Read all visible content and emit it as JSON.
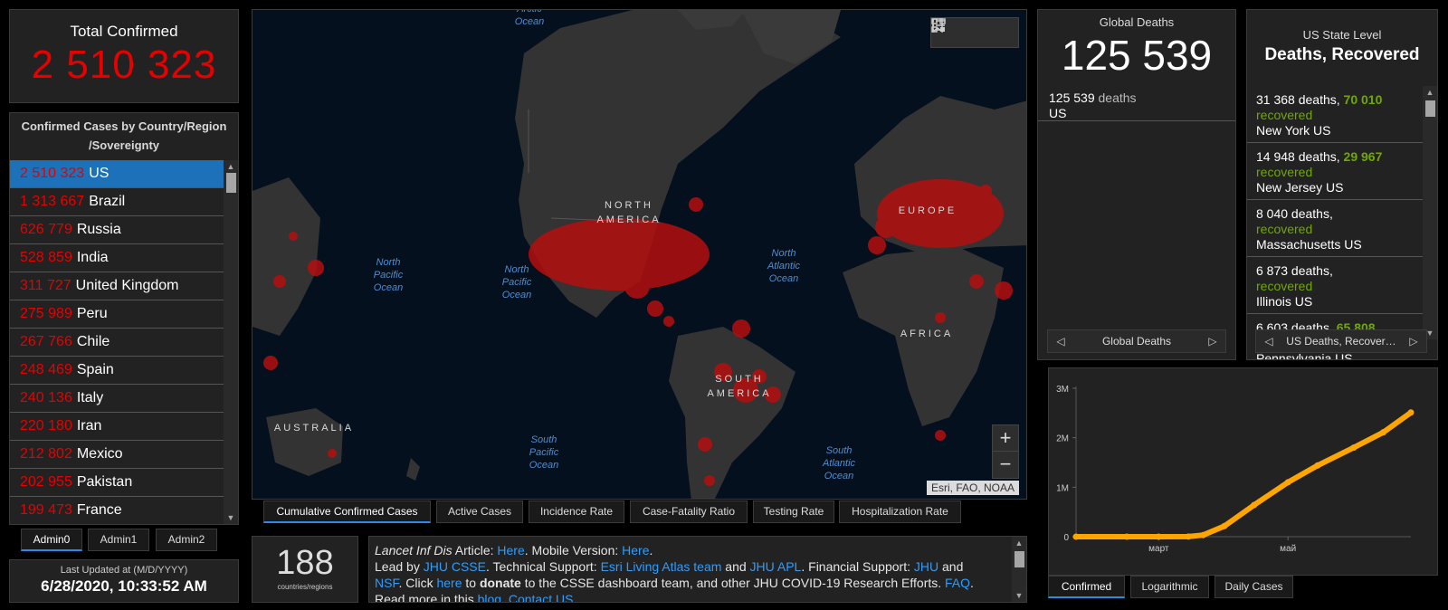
{
  "total": {
    "title": "Total Confirmed",
    "value": "2 510 323"
  },
  "countries": {
    "header_line1": "Confirmed Cases by Country/Region",
    "header_line2": "/Sovereignty",
    "items": [
      {
        "count": "2 510 323",
        "name": "US"
      },
      {
        "count": "1 313 667",
        "name": "Brazil"
      },
      {
        "count": "626 779",
        "name": "Russia"
      },
      {
        "count": "528 859",
        "name": "India"
      },
      {
        "count": "311 727",
        "name": "United Kingdom"
      },
      {
        "count": "275 989",
        "name": "Peru"
      },
      {
        "count": "267 766",
        "name": "Chile"
      },
      {
        "count": "248 469",
        "name": "Spain"
      },
      {
        "count": "240 136",
        "name": "Italy"
      },
      {
        "count": "220 180",
        "name": "Iran"
      },
      {
        "count": "212 802",
        "name": "Mexico"
      },
      {
        "count": "202 955",
        "name": "Pakistan"
      },
      {
        "count": "199 473",
        "name": "France"
      }
    ]
  },
  "admin_tabs": [
    "Admin0",
    "Admin1",
    "Admin2"
  ],
  "last_updated": {
    "title": "Last Updated at (M/D/YYYY)",
    "value": "6/28/2020, 10:33:52 AM"
  },
  "map": {
    "labels": {
      "arctic": "Arctic\nOcean",
      "north_pacific_w": "North\nPacific\nOcean",
      "north_pacific_e": "North\nPacific\nOcean",
      "north_atlantic": "North\nAtlantic\nOcean",
      "south_pacific": "South\nPacific\nOcean",
      "south_atlantic": "South\nAtlantic\nOcean",
      "north_america": "NORTH\nAMERICA",
      "south_america": "SOUTH\nAMERICA",
      "europe": "EUROPE",
      "africa": "AFRICA",
      "australia": "AUSTRALIA"
    },
    "attribution": "Esri, FAO, NOAA",
    "zoom_in": "+",
    "zoom_out": "−",
    "tabs": [
      "Cumulative Confirmed Cases",
      "Active Cases",
      "Incidence Rate",
      "Case-Fatality Ratio",
      "Testing Rate",
      "Hospitalization Rate"
    ]
  },
  "countries_count": {
    "value": "188",
    "label": "countries/regions"
  },
  "info": {
    "lancet": "Lancet Inf Dis",
    "article": " Article: ",
    "here1": "Here",
    "mobile": ". Mobile Version: ",
    "here2": "Here",
    "dot1": ".",
    "lead": "Lead by ",
    "jhu_csse": "JHU CSSE",
    "tech": ". Technical Support: ",
    "esri": "Esri Living Atlas team",
    "and1": " and ",
    "jhu_apl": "JHU APL",
    "fin": ". Financial Support: ",
    "jhu": "JHU",
    "and2": " and",
    "nsf": "NSF",
    "click": ". Click ",
    "here3": "here",
    "to": " to ",
    "donate": "donate",
    "rest": " to the CSSE dashboard team, and other JHU COVID-19 Research Efforts. ",
    "faq": "FAQ",
    "read": ". Read more in this ",
    "blog": "blog",
    "dot2": ". ",
    "contact": "Contact US",
    "dot3": "."
  },
  "global_deaths": {
    "title": "Global Deaths",
    "value": "125 539",
    "entry_count": "125 539",
    "entry_label": "deaths",
    "entry_country": "US",
    "pager": "Global Deaths"
  },
  "us_state": {
    "title": "US State Level",
    "subtitle": "Deaths, Recovered",
    "rows": [
      {
        "deaths": "31 368 deaths,",
        "recovered_num": "70 010",
        "recovered": "recovered",
        "place": "New York US"
      },
      {
        "deaths": "14 948 deaths,",
        "recovered_num": "29 967",
        "recovered": "recovered",
        "place": "New Jersey US"
      },
      {
        "deaths": "8 040 deaths,",
        "recovered_num": "",
        "recovered": "recovered",
        "place": "Massachusetts US"
      },
      {
        "deaths": "6 873 deaths,",
        "recovered_num": "",
        "recovered": "recovered",
        "place": "Illinois US"
      },
      {
        "deaths": "6 603 deaths,",
        "recovered_num": "65 808",
        "recovered": "recovered",
        "place": "Pennsylvania US"
      }
    ],
    "pager": "US Deaths, Recover…"
  },
  "chart_tabs": [
    "Confirmed",
    "Logarithmic",
    "Daily Cases"
  ],
  "chart_data": {
    "type": "line",
    "title": "",
    "xlabel": "",
    "ylabel": "",
    "y_tick_labels": [
      "0",
      "1M",
      "2M",
      "3M"
    ],
    "y_ticks": [
      0,
      1000000,
      2000000,
      3000000
    ],
    "x_tick_labels": [
      "март",
      "май"
    ],
    "x_ticks": [
      "2020-03-01",
      "2020-05-01"
    ],
    "xlim": [
      "2020-01-22",
      "2020-06-28"
    ],
    "ylim": [
      0,
      3000000
    ],
    "color": "#ffa500",
    "x": [
      "2020-01-22",
      "2020-02-15",
      "2020-03-01",
      "2020-03-15",
      "2020-03-22",
      "2020-04-01",
      "2020-04-15",
      "2020-05-01",
      "2020-05-15",
      "2020-06-01",
      "2020-06-15",
      "2020-06-28"
    ],
    "y": [
      0,
      15,
      75,
      3000,
      33000,
      214000,
      640000,
      1100000,
      1440000,
      1800000,
      2110000,
      2510000
    ]
  },
  "colors": {
    "accent": "#1c71b8",
    "red": "#e60000",
    "green": "#70a800",
    "line": "#ffa500"
  }
}
